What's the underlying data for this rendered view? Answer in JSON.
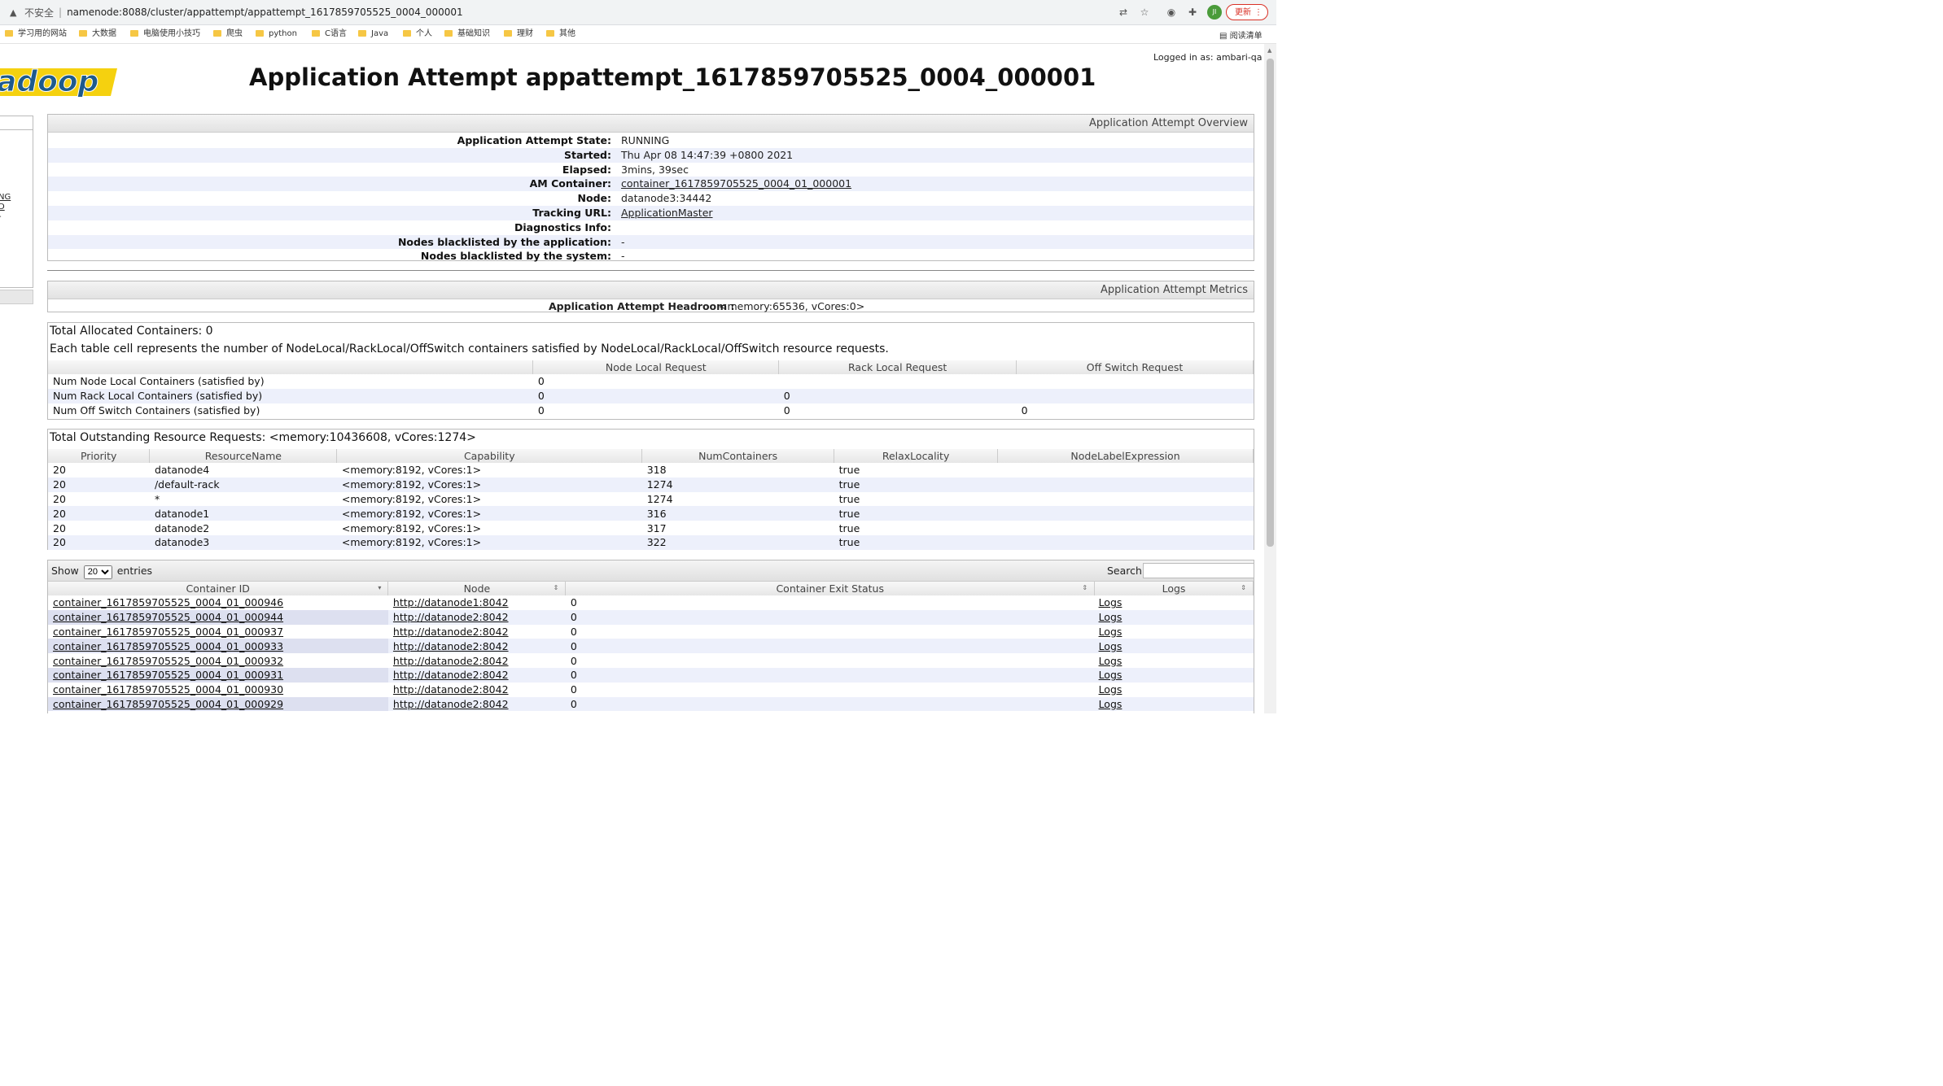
{
  "browser": {
    "insecure_label": "不安全",
    "url": "namenode:8088/cluster/appattempt/appattempt_1617859705525_0004_000001",
    "avatar_initials": "JI",
    "update_label": "更新",
    "reading_list_label": "阅读清单",
    "bookmarks": [
      "学习用的网站",
      "大数据",
      "电脑使用小技巧",
      "爬虫",
      "python",
      "C语言",
      "Java",
      "个人",
      "基础知识",
      "理财",
      "其他"
    ]
  },
  "header": {
    "logo_text": "adoop",
    "logged_in": "Logged in as: ambari-qa",
    "title": "Application Attempt appattempt_1617859705525_0004_000001"
  },
  "leftnav": {
    "link1": "NG",
    "link2": "D",
    "link3": "-"
  },
  "overview": {
    "heading": "Application Attempt Overview",
    "rows": [
      {
        "key": "Application Attempt State:",
        "value": "RUNNING"
      },
      {
        "key": "Started:",
        "value": "Thu Apr 08 14:47:39 +0800 2021"
      },
      {
        "key": "Elapsed:",
        "value": "3mins, 39sec"
      },
      {
        "key": "AM Container:",
        "value": "container_1617859705525_0004_01_000001"
      },
      {
        "key": "Node:",
        "value": "datanode3:34442"
      },
      {
        "key": "Tracking URL:",
        "value": "ApplicationMaster"
      },
      {
        "key": "Diagnostics Info:",
        "value": ""
      },
      {
        "key": "Nodes blacklisted by the application:",
        "value": "-"
      },
      {
        "key": "Nodes blacklisted by the system:",
        "value": "-"
      }
    ]
  },
  "metrics": {
    "heading": "Application Attempt Metrics",
    "headroom_key": "Application Attempt Headroom :",
    "headroom_value": "<memory:65536, vCores:0>"
  },
  "allocated": {
    "total": "Total Allocated Containers: 0",
    "description": "Each table cell represents the number of NodeLocal/RackLocal/OffSwitch containers satisfied by NodeLocal/RackLocal/OffSwitch resource requests.",
    "columns": [
      "",
      "Node Local Request",
      "Rack Local Request",
      "Off Switch Request"
    ],
    "rows": [
      [
        "Num Node Local Containers (satisfied by)",
        "0",
        "",
        ""
      ],
      [
        "Num Rack Local Containers (satisfied by)",
        "0",
        "0",
        ""
      ],
      [
        "Num Off Switch Containers (satisfied by)",
        "0",
        "0",
        "0"
      ]
    ]
  },
  "outstanding": {
    "total": "Total Outstanding Resource Requests: <memory:10436608, vCores:1274>",
    "columns": [
      "Priority",
      "ResourceName",
      "Capability",
      "NumContainers",
      "RelaxLocality",
      "NodeLabelExpression"
    ],
    "rows": [
      [
        "20",
        "datanode4",
        "<memory:8192, vCores:1>",
        "318",
        "true",
        ""
      ],
      [
        "20",
        "/default-rack",
        "<memory:8192, vCores:1>",
        "1274",
        "true",
        ""
      ],
      [
        "20",
        "*",
        "<memory:8192, vCores:1>",
        "1274",
        "true",
        ""
      ],
      [
        "20",
        "datanode1",
        "<memory:8192, vCores:1>",
        "316",
        "true",
        ""
      ],
      [
        "20",
        "datanode2",
        "<memory:8192, vCores:1>",
        "317",
        "true",
        ""
      ],
      [
        "20",
        "datanode3",
        "<memory:8192, vCores:1>",
        "322",
        "true",
        ""
      ]
    ]
  },
  "containers": {
    "show_label": "Show",
    "entries_value": "20",
    "entries_label": "entries",
    "search_label": "Search:",
    "columns": [
      "Container ID",
      "Node",
      "Container Exit Status",
      "Logs"
    ],
    "rows": [
      [
        "container_1617859705525_0004_01_000946",
        "http://datanode1:8042",
        "0",
        "Logs"
      ],
      [
        "container_1617859705525_0004_01_000944",
        "http://datanode2:8042",
        "0",
        "Logs"
      ],
      [
        "container_1617859705525_0004_01_000937",
        "http://datanode2:8042",
        "0",
        "Logs"
      ],
      [
        "container_1617859705525_0004_01_000933",
        "http://datanode2:8042",
        "0",
        "Logs"
      ],
      [
        "container_1617859705525_0004_01_000932",
        "http://datanode2:8042",
        "0",
        "Logs"
      ],
      [
        "container_1617859705525_0004_01_000931",
        "http://datanode2:8042",
        "0",
        "Logs"
      ],
      [
        "container_1617859705525_0004_01_000930",
        "http://datanode2:8042",
        "0",
        "Logs"
      ],
      [
        "container_1617859705525_0004_01_000929",
        "http://datanode2:8042",
        "0",
        "Logs"
      ]
    ]
  },
  "colors": {
    "row_alt": "#edf0fb",
    "logo_blue": "#1e5a8c",
    "update_red": "#d93025"
  }
}
